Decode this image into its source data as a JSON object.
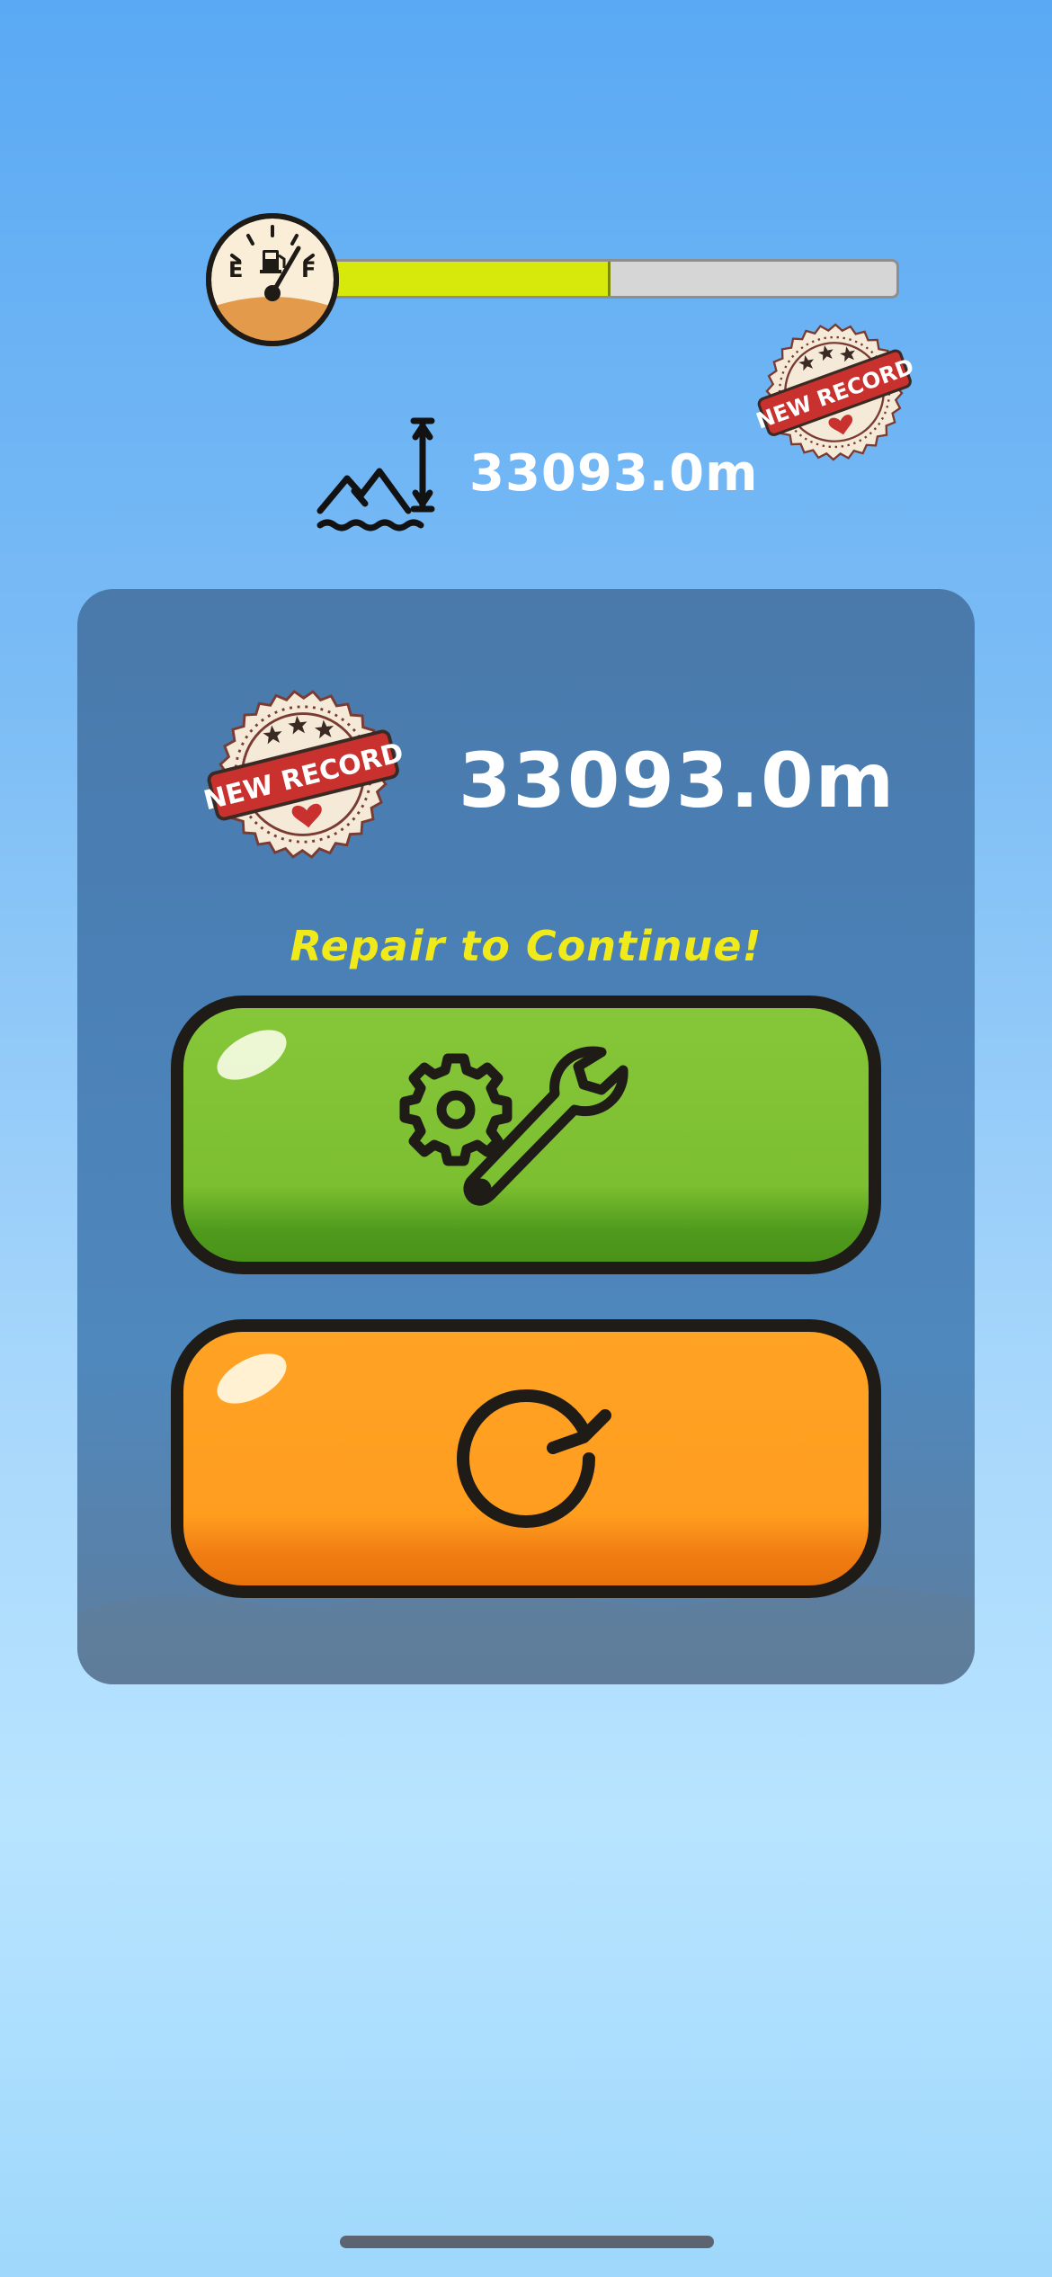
{
  "hud": {
    "fuel": {
      "empty_label": "E",
      "full_label": "F",
      "level": 0.5,
      "fill_color": "#d7e80b",
      "icon": "fuel-pump-icon"
    },
    "altitude": {
      "icon": "altitude-icon",
      "value": "33093.0m"
    },
    "record_stamp": {
      "text": "NEW RECORD",
      "icon": "heart-icon"
    }
  },
  "game_over_panel": {
    "record_stamp": {
      "text": "NEW RECORD",
      "icon": "heart-icon"
    },
    "best_distance": "33093.0m",
    "prompt": "Repair to Continue!",
    "buttons": {
      "repair": {
        "icon": "gear-wrench-icon",
        "color": "#7cbf30"
      },
      "restart": {
        "icon": "restart-icon",
        "color": "#ff9d1f"
      }
    }
  }
}
